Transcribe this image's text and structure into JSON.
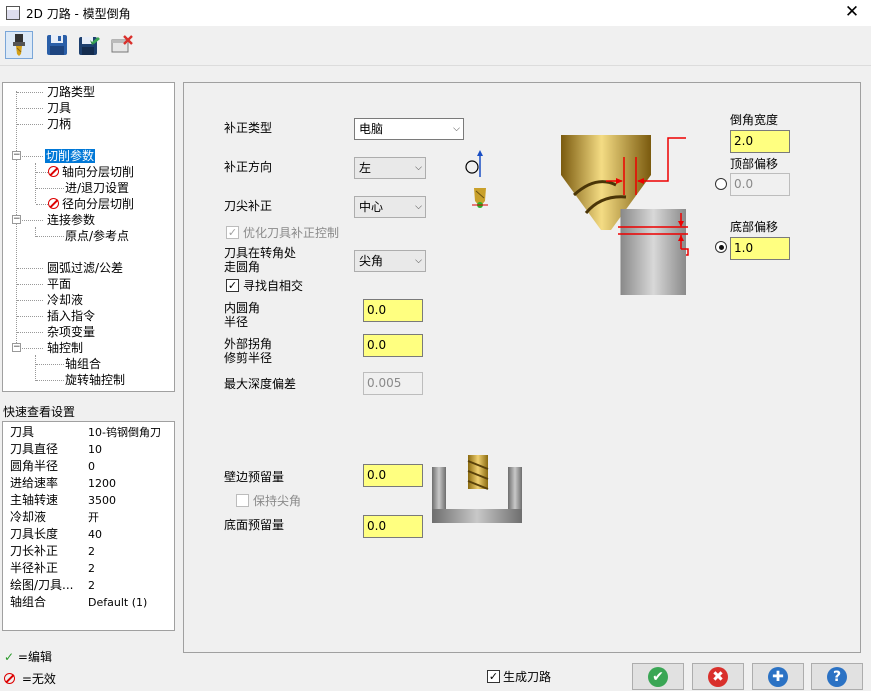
{
  "window": {
    "title": "2D 刀路 - 模型倒角",
    "close_label": "✕"
  },
  "toolbar": {
    "items": [
      {
        "name": "tool-icon"
      },
      {
        "name": "save-icon"
      },
      {
        "name": "save-as-icon"
      },
      {
        "name": "delete-icon"
      }
    ]
  },
  "tree": {
    "items": [
      {
        "label": "刀路类型"
      },
      {
        "label": "刀具"
      },
      {
        "label": "刀柄"
      },
      {
        "label": "切削参数"
      },
      {
        "label": "轴向分层切削"
      },
      {
        "label": "进/退刀设置"
      },
      {
        "label": "径向分层切削"
      },
      {
        "label": "连接参数"
      },
      {
        "label": "原点/参考点"
      },
      {
        "label": "圆弧过滤/公差"
      },
      {
        "label": "平面"
      },
      {
        "label": "冷却液"
      },
      {
        "label": "插入指令"
      },
      {
        "label": "杂项变量"
      },
      {
        "label": "轴控制"
      },
      {
        "label": "轴组合"
      },
      {
        "label": "旋转轴控制"
      }
    ]
  },
  "quick_view": {
    "title": "快速查看设置",
    "rows": [
      {
        "k": "刀具",
        "v": "10-钨钢倒角刀"
      },
      {
        "k": "刀具直径",
        "v": "10"
      },
      {
        "k": "圆角半径",
        "v": "0"
      },
      {
        "k": "进给速率",
        "v": "1200"
      },
      {
        "k": "主轴转速",
        "v": "3500"
      },
      {
        "k": "冷却液",
        "v": "开"
      },
      {
        "k": "刀具长度",
        "v": "40"
      },
      {
        "k": "刀长补正",
        "v": "2"
      },
      {
        "k": "半径补正",
        "v": "2"
      },
      {
        "k": "绘图/刀具...",
        "v": "2"
      },
      {
        "k": "轴组合",
        "v": "Default (1)"
      }
    ]
  },
  "legend": {
    "edit": "=编辑",
    "invalid": "=无效"
  },
  "params": {
    "comp_type": {
      "label": "补正类型",
      "value": "电脑"
    },
    "comp_dir": {
      "label": "补正方向",
      "value": "左"
    },
    "tip_comp": {
      "label": "刀尖补正",
      "value": "中心"
    },
    "optimize": {
      "label": "优化刀具补正控制",
      "checked": true
    },
    "corner_round": {
      "label1": "刀具在转角处",
      "label2": "走圆角",
      "value": "尖角"
    },
    "find_self": {
      "label": "寻找自相交",
      "checked": true
    },
    "inner_radius": {
      "label1": "内圆角",
      "label2": "半径",
      "value": "0.0"
    },
    "outer_trim": {
      "label1": "外部拐角",
      "label2": "修剪半径",
      "value": "0.0"
    },
    "max_depth": {
      "label": "最大深度偏差",
      "value": "0.005"
    },
    "wall_stock": {
      "label": "壁边预留量",
      "value": "0.0"
    },
    "keep_tip": {
      "label": "保持尖角",
      "checked": false
    },
    "floor_stock": {
      "label": "底面预留量",
      "value": "0.0"
    },
    "chamfer_width": {
      "label": "倒角宽度",
      "value": "2.0"
    },
    "top_offset": {
      "label": "顶部偏移",
      "value": "0.0",
      "selected": false
    },
    "bottom_offset": {
      "label": "底部偏移",
      "value": "1.0",
      "selected": true
    }
  },
  "footer": {
    "generate": {
      "label": "生成刀路",
      "checked": true
    },
    "buttons": [
      {
        "name": "ok",
        "symbol": "✔",
        "color": "#3aa655"
      },
      {
        "name": "cancel",
        "symbol": "✖",
        "color": "#d9302c"
      },
      {
        "name": "apply",
        "symbol": "✚",
        "color": "#2b72c4"
      },
      {
        "name": "help",
        "symbol": "?",
        "color": "#2b72c4"
      }
    ]
  }
}
